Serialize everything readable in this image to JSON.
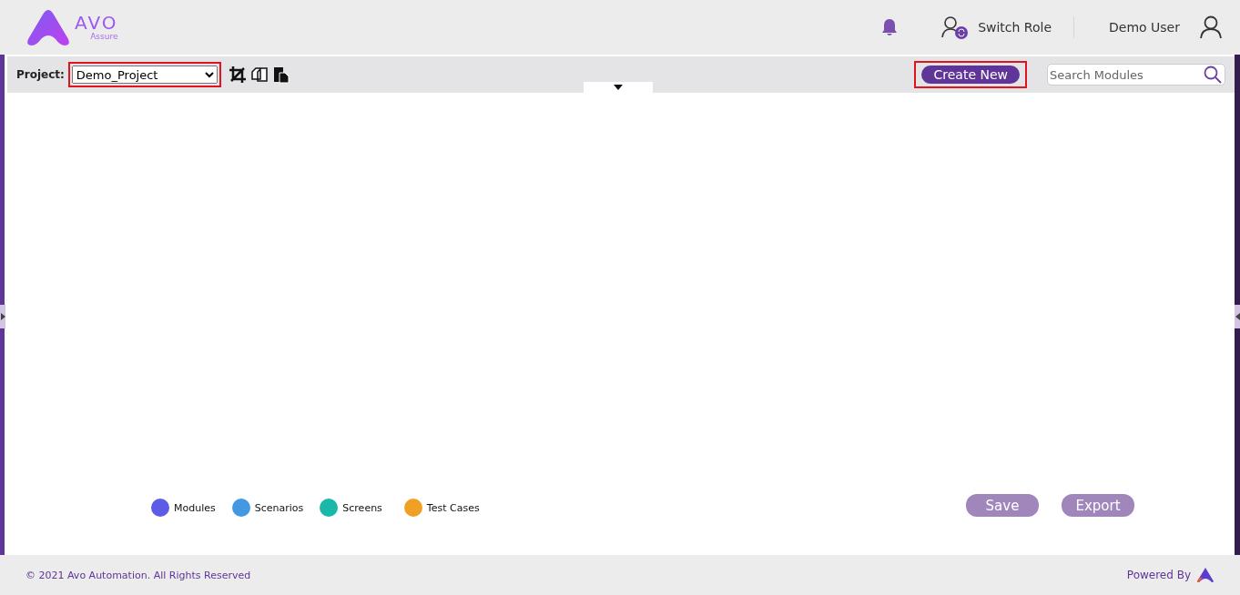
{
  "header": {
    "logo_text": "AVO",
    "logo_subtext": "Assure",
    "switch_role": "Switch Role",
    "user": "Demo User"
  },
  "toolbar": {
    "project_label": "Project:",
    "project_value": "Demo_Project",
    "create_button": "Create New",
    "search": {
      "placeholder": "Search Modules"
    }
  },
  "legend": [
    {
      "label": "Modules",
      "color": "#5c5ce6"
    },
    {
      "label": "Scenarios",
      "color": "#4299e1"
    },
    {
      "label": "Screens",
      "color": "#19b8a8"
    },
    {
      "label": "Test Cases",
      "color": "#f0a024"
    }
  ],
  "actions": [
    {
      "label": "Save",
      "disabled": true
    },
    {
      "label": "Export",
      "disabled": true
    }
  ],
  "footer": {
    "copyright": "© 2021 Avo Automation. All Rights Reserved",
    "powered_by": "Powered By"
  }
}
